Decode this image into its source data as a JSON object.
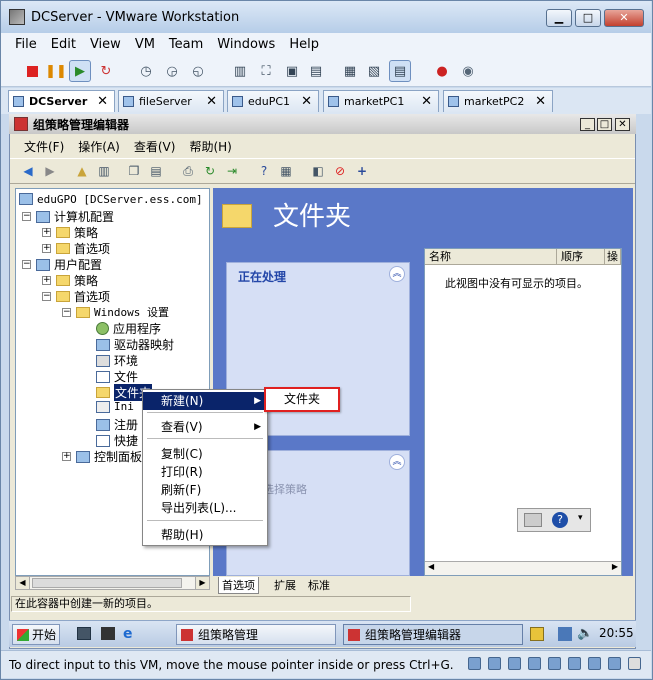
{
  "window": {
    "title": "DCServer - VMware Workstation"
  },
  "menubar": [
    "File",
    "Edit",
    "View",
    "VM",
    "Team",
    "Windows",
    "Help"
  ],
  "tabs": [
    {
      "label": "DCServer",
      "active": true
    },
    {
      "label": "fileServer"
    },
    {
      "label": "eduPC1"
    },
    {
      "label": "marketPC1"
    },
    {
      "label": "marketPC2"
    }
  ],
  "guest": {
    "title": "组策略管理编辑器",
    "menu": [
      "文件(F)",
      "操作(A)",
      "查看(V)",
      "帮助(H)"
    ],
    "tree": {
      "root": "eduGPO [DCServer.ess.com] 策",
      "computer_config": "计算机配置",
      "computer_policy": "策略",
      "computer_prefs": "首选项",
      "user_config": "用户配置",
      "user_policy": "策略",
      "user_prefs": "首选项",
      "windows_settings": "Windows 设置",
      "apps": "应用程序",
      "drive_maps": "驱动器映射",
      "env": "环境",
      "files": "文件",
      "folders": "文件夹",
      "ini": "Ini",
      "registry": "注册",
      "shortcuts": "快捷",
      "control_panel": "控制面板"
    },
    "right": {
      "title": "文件夹",
      "processing_title": "正在处理",
      "select_policy": "选择策略",
      "columns": [
        "名称",
        "顺序",
        "操"
      ],
      "empty_text": "此视图中没有可显示的项目。"
    },
    "bottom_tabs": [
      "首选项",
      "扩展",
      "标准"
    ],
    "status": "在此容器中创建一新的项目。",
    "context_menu": {
      "items": [
        "新建(N)",
        "查看(V)",
        "复制(C)",
        "打印(R)",
        "刷新(F)",
        "导出列表(L)...",
        "帮助(H)"
      ]
    },
    "submenu_item": "文件夹",
    "taskbar": {
      "start": "开始",
      "tasks": [
        "组策略管理",
        "组策略管理编辑器"
      ],
      "time": "20:55"
    }
  },
  "vm_status": "To direct input to this VM, move the mouse pointer inside or press Ctrl+G."
}
